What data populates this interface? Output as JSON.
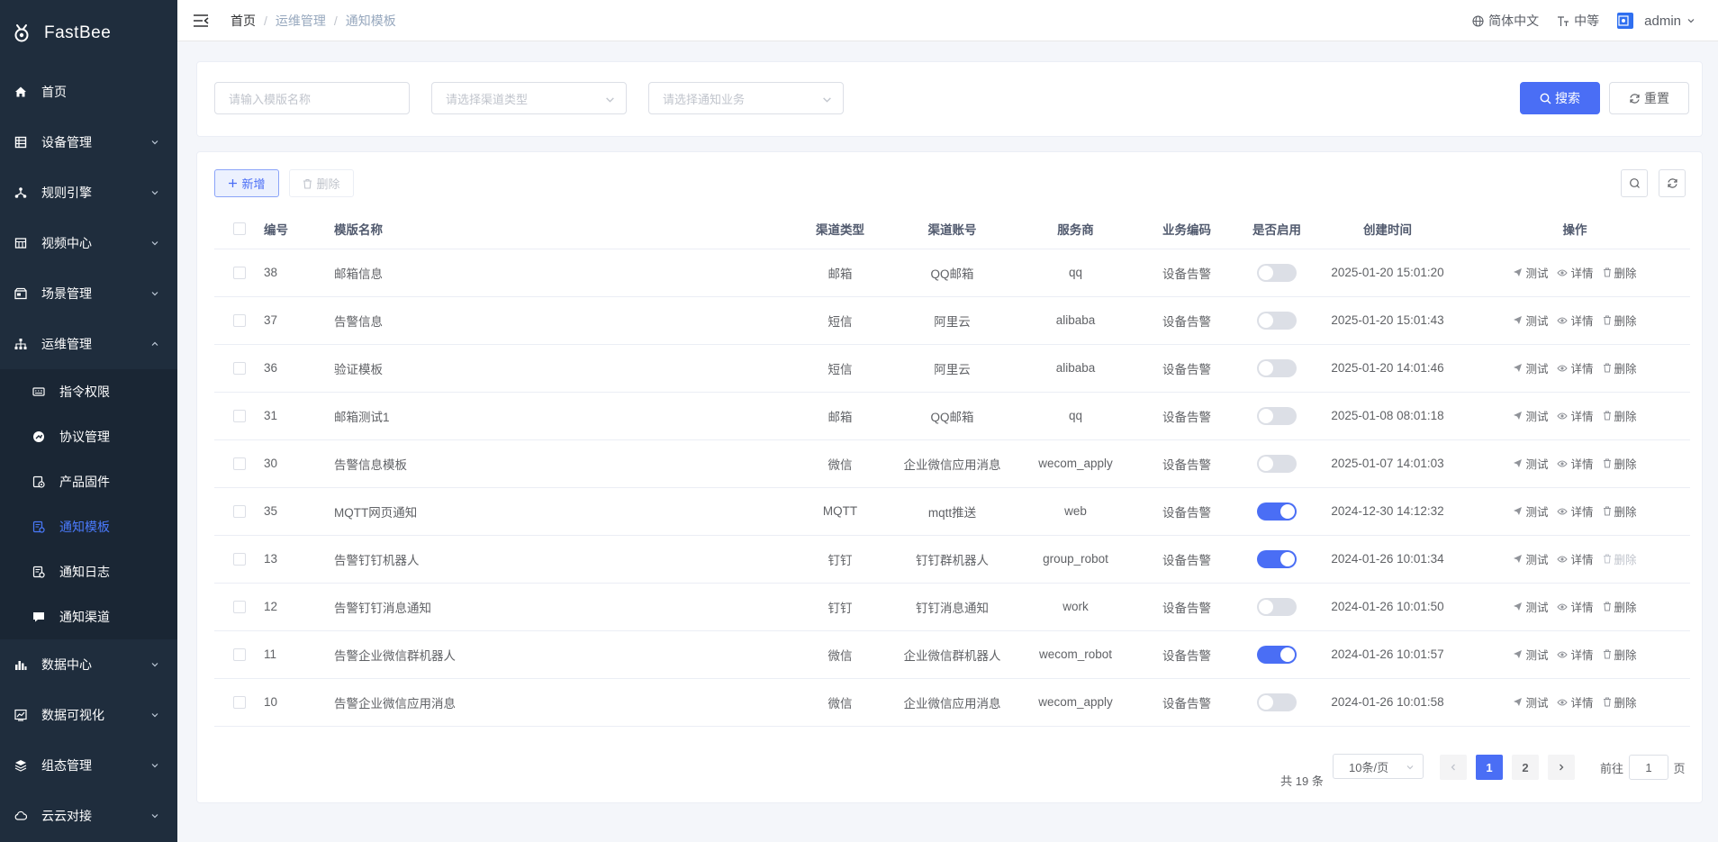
{
  "app": {
    "name": "FastBee"
  },
  "sidebar": {
    "items": [
      {
        "key": "home",
        "label": "首页",
        "icon": "home-icon",
        "has_children": false
      },
      {
        "key": "device",
        "label": "设备管理",
        "icon": "device-icon",
        "has_children": true
      },
      {
        "key": "rules",
        "label": "规则引擎",
        "icon": "rule-icon",
        "has_children": true
      },
      {
        "key": "video",
        "label": "视频中心",
        "icon": "video-icon",
        "has_children": true
      },
      {
        "key": "scene",
        "label": "场景管理",
        "icon": "scene-icon",
        "has_children": true
      },
      {
        "key": "ops",
        "label": "运维管理",
        "icon": "ops-icon",
        "has_children": true,
        "expanded": true
      }
    ],
    "sub_items": [
      {
        "label": "指令权限",
        "icon": "command-icon"
      },
      {
        "label": "协议管理",
        "icon": "protocol-icon"
      },
      {
        "label": "产品固件",
        "icon": "firmware-icon"
      },
      {
        "label": "通知模板",
        "icon": "template-icon",
        "active": true
      },
      {
        "label": "通知日志",
        "icon": "log-icon"
      },
      {
        "label": "通知渠道",
        "icon": "channel-icon"
      }
    ],
    "bottom_items": [
      {
        "label": "数据中心",
        "icon": "data-icon"
      },
      {
        "label": "数据可视化",
        "icon": "chart-icon"
      },
      {
        "label": "组态管理",
        "icon": "layers-icon"
      },
      {
        "label": "云云对接",
        "icon": "cloud-icon"
      }
    ]
  },
  "header": {
    "breadcrumb": [
      "首页",
      "运维管理",
      "通知模板"
    ],
    "language": "简体中文",
    "size": "中等",
    "user": "admin"
  },
  "search": {
    "name_placeholder": "请输入模版名称",
    "channel_placeholder": "请选择渠道类型",
    "business_placeholder": "请选择通知业务",
    "search_label": "搜索",
    "reset_label": "重置"
  },
  "toolbar": {
    "add_label": "新增",
    "delete_label": "删除"
  },
  "table": {
    "headers": [
      "编号",
      "模版名称",
      "渠道类型",
      "渠道账号",
      "服务商",
      "业务编码",
      "是否启用",
      "创建时间",
      "操作"
    ],
    "ops": {
      "test": "测试",
      "detail": "详情",
      "delete": "删除"
    },
    "rows": [
      {
        "id": "38",
        "name": "邮箱信息",
        "channel": "邮箱",
        "account": "QQ邮箱",
        "provider": "qq",
        "business": "设备告警",
        "enabled": false,
        "created": "2025-01-20 15:01:20",
        "delete_disabled": false
      },
      {
        "id": "37",
        "name": "告警信息",
        "channel": "短信",
        "account": "阿里云",
        "provider": "alibaba",
        "business": "设备告警",
        "enabled": false,
        "created": "2025-01-20 15:01:43",
        "delete_disabled": false
      },
      {
        "id": "36",
        "name": "验证模板",
        "channel": "短信",
        "account": "阿里云",
        "provider": "alibaba",
        "business": "设备告警",
        "enabled": false,
        "created": "2025-01-20 14:01:46",
        "delete_disabled": false
      },
      {
        "id": "31",
        "name": "邮箱测试1",
        "channel": "邮箱",
        "account": "QQ邮箱",
        "provider": "qq",
        "business": "设备告警",
        "enabled": false,
        "created": "2025-01-08 08:01:18",
        "delete_disabled": false
      },
      {
        "id": "30",
        "name": "告警信息模板",
        "channel": "微信",
        "account": "企业微信应用消息",
        "provider": "wecom_apply",
        "business": "设备告警",
        "enabled": false,
        "created": "2025-01-07 14:01:03",
        "delete_disabled": false
      },
      {
        "id": "35",
        "name": "MQTT网页通知",
        "channel": "MQTT",
        "account": "mqtt推送",
        "provider": "web",
        "business": "设备告警",
        "enabled": true,
        "created": "2024-12-30 14:12:32",
        "delete_disabled": false
      },
      {
        "id": "13",
        "name": "告警钉钉机器人",
        "channel": "钉钉",
        "account": "钉钉群机器人",
        "provider": "group_robot",
        "business": "设备告警",
        "enabled": true,
        "created": "2024-01-26 10:01:34",
        "delete_disabled": true
      },
      {
        "id": "12",
        "name": "告警钉钉消息通知",
        "channel": "钉钉",
        "account": "钉钉消息通知",
        "provider": "work",
        "business": "设备告警",
        "enabled": false,
        "created": "2024-01-26 10:01:50",
        "delete_disabled": false
      },
      {
        "id": "11",
        "name": "告警企业微信群机器人",
        "channel": "微信",
        "account": "企业微信群机器人",
        "provider": "wecom_robot",
        "business": "设备告警",
        "enabled": true,
        "created": "2024-01-26 10:01:57",
        "delete_disabled": false
      },
      {
        "id": "10",
        "name": "告警企业微信应用消息",
        "channel": "微信",
        "account": "企业微信应用消息",
        "provider": "wecom_apply",
        "business": "设备告警",
        "enabled": false,
        "created": "2024-01-26 10:01:58",
        "delete_disabled": false
      }
    ]
  },
  "pagination": {
    "total_text": "共 19 条",
    "page_size": "10条/页",
    "pages": [
      "1",
      "2"
    ],
    "current": "1",
    "goto_prefix": "前往",
    "goto_value": "1",
    "goto_suffix": "页"
  },
  "colors": {
    "primary": "#4a6ef5",
    "sidebar_bg": "#1f2d3d",
    "active_menu": "#4a7afc"
  }
}
